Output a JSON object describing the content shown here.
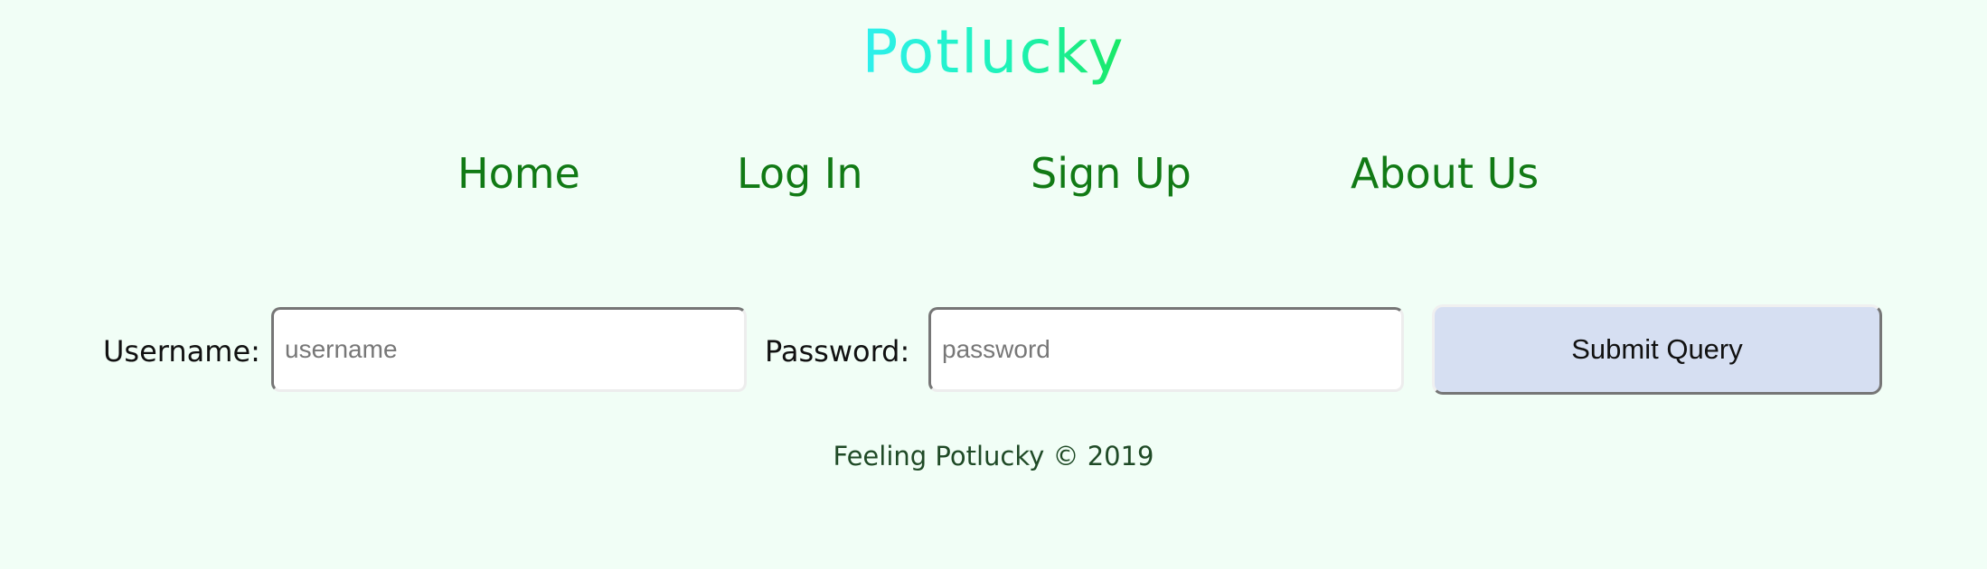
{
  "header": {
    "brand": "Potlucky"
  },
  "nav": {
    "items": [
      {
        "label": "Home"
      },
      {
        "label": "Log In"
      },
      {
        "label": "Sign Up"
      },
      {
        "label": "About Us"
      }
    ]
  },
  "login_form": {
    "username_label": "Username:",
    "username_placeholder": "username",
    "password_label": "Password:",
    "password_placeholder": "password",
    "submit_label": "Submit Query"
  },
  "footer": {
    "text": "Feeling Potlucky © 2019"
  },
  "colors": {
    "background": "#f1fef6",
    "nav_link": "#117a15",
    "brand_gradient_start": "#2ff0ee",
    "brand_gradient_end": "#19e863",
    "submit_background": "#d6dff2",
    "footer_text": "#1f4a26"
  }
}
